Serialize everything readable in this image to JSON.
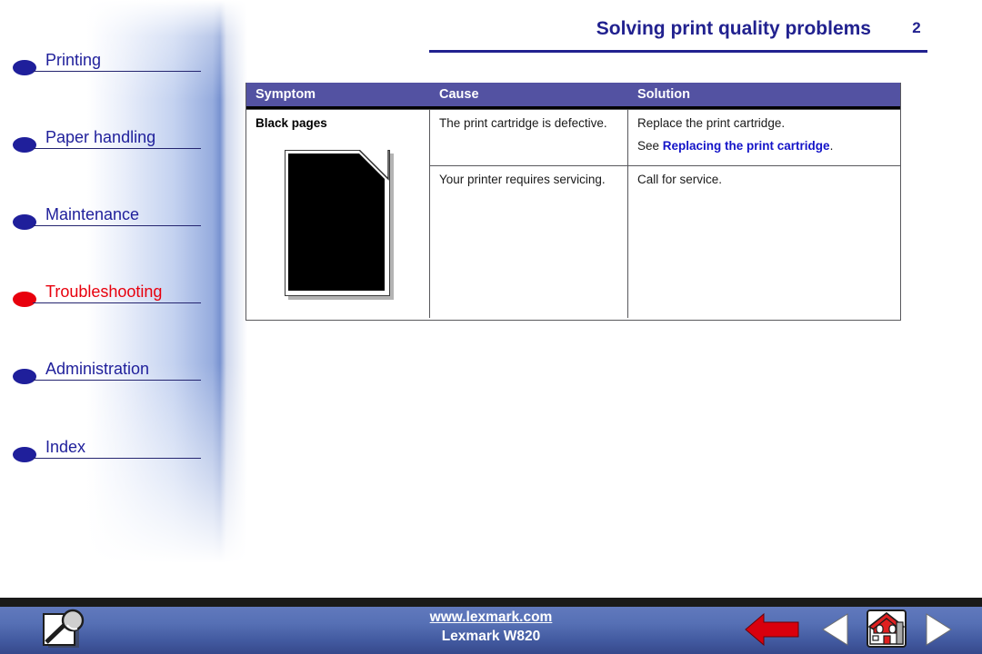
{
  "header": {
    "title": "Solving print quality problems",
    "page_number": "2"
  },
  "sidebar": {
    "items": [
      {
        "label": "Printing",
        "bullet_color": "#1f1f9b",
        "active": false
      },
      {
        "label": "Paper handling",
        "bullet_color": "#1f1f9b",
        "active": false
      },
      {
        "label": "Maintenance",
        "bullet_color": "#1f1f9b",
        "active": false
      },
      {
        "label": "Troubleshooting",
        "bullet_color": "#e8000d",
        "active": true
      },
      {
        "label": "Administration",
        "bullet_color": "#1f1f9b",
        "active": false
      },
      {
        "label": "Index",
        "bullet_color": "#1f1f9b",
        "active": false
      }
    ]
  },
  "table": {
    "columns": [
      "Symptom",
      "Cause",
      "Solution"
    ],
    "rows": [
      {
        "symptom": "Black pages",
        "symptom_graphic": "black-page-sample",
        "cause": "The print cartridge is defective.",
        "solution_line1": "Replace the print cartridge.",
        "solution_prefix": "See ",
        "solution_link": "Replacing the print cartridge",
        "solution_suffix": "."
      },
      {
        "cause": "Your printer requires servicing.",
        "solution_line1": "Call for service."
      }
    ]
  },
  "footer": {
    "url": "www.lexmark.com",
    "model": "Lexmark W820",
    "icons": [
      "search-icon",
      "back-arrow-icon",
      "previous-page-icon",
      "home-icon",
      "next-page-icon"
    ]
  },
  "colors": {
    "nav_blue": "#1f1f9b",
    "nav_active_red": "#e8000d",
    "header_blue": "#21218f",
    "table_header_bg": "#5352a2",
    "link_blue": "#1414c8",
    "footer_blue": "#5670b5"
  }
}
